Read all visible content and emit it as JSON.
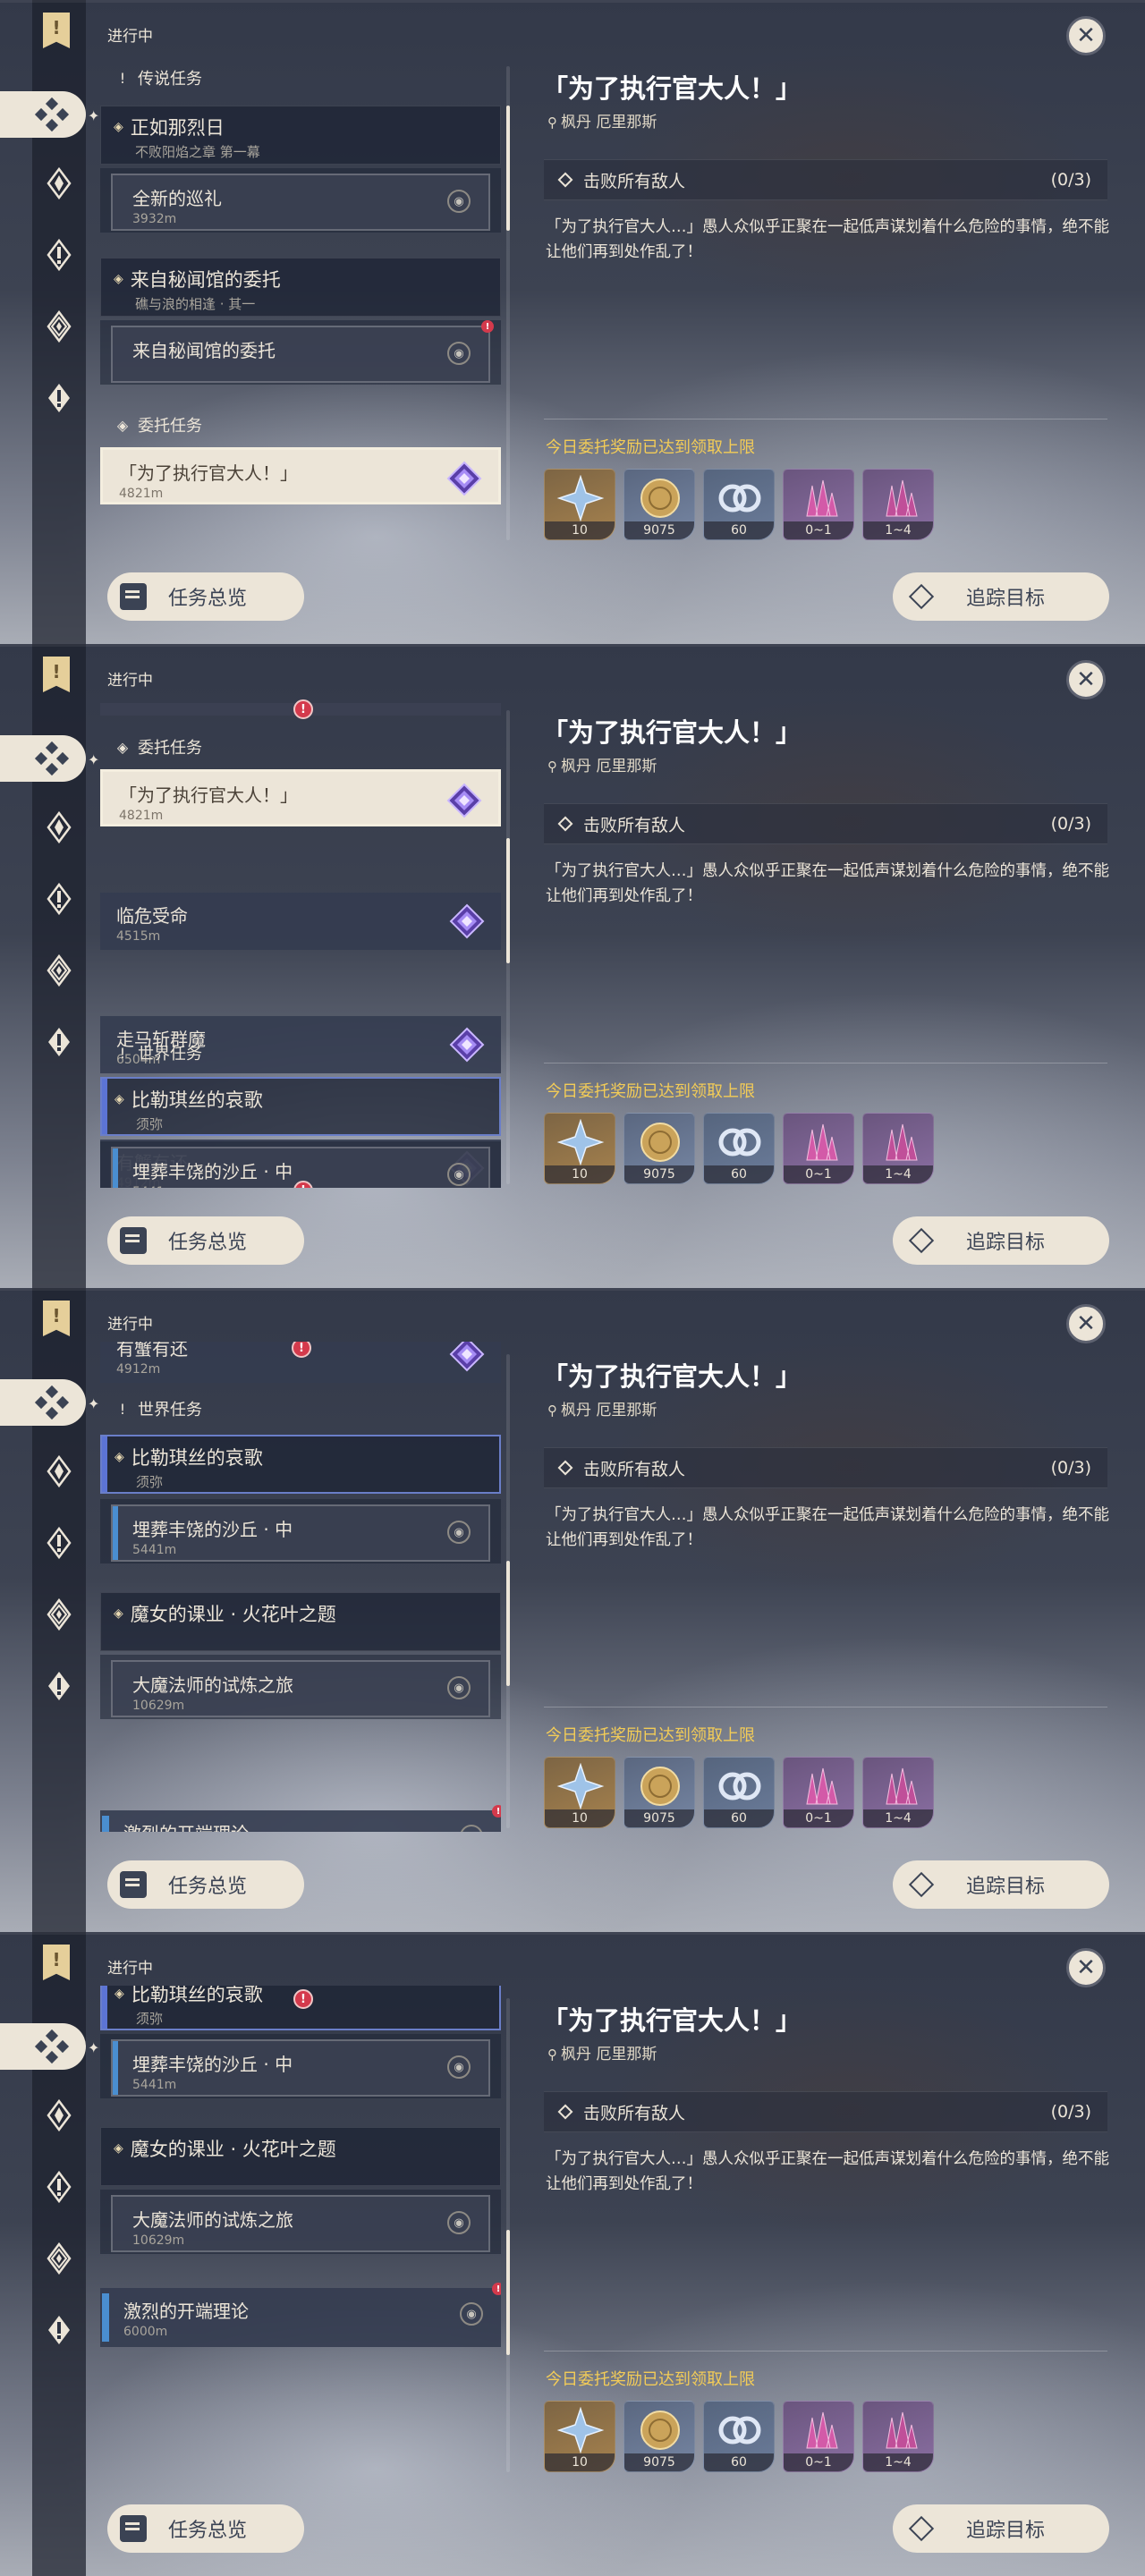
{
  "status_label": "进行中",
  "sections": {
    "legend": "传说任务",
    "commission": "委托任务",
    "world": "世界任务"
  },
  "quests": {
    "lieri": {
      "title": "正如那烈日",
      "sub": "不败阳焰之章 第一幕"
    },
    "xunli": {
      "title": "全新的巡礼",
      "dist": "3932m"
    },
    "mimi": {
      "title": "来自秘闻馆的委托",
      "sub": "礁与浪的相逢 · 其一"
    },
    "mimi_child": {
      "title": "来自秘闻馆的委托"
    },
    "zhixing": {
      "title": "「为了执行官大人！」",
      "dist": "4821m"
    },
    "linwei": {
      "title": "临危受命",
      "dist": "4515m"
    },
    "zouma": {
      "title": "走马斩群魔",
      "dist": "6504m"
    },
    "youxie": {
      "title": "有蟹有还",
      "dist": "4912m"
    },
    "bileqi": {
      "title": "比勒琪丝的哀歌",
      "sub": "须弥"
    },
    "maizang": {
      "title": "埋葬丰饶的沙丘 · 中",
      "dist": "5441m"
    },
    "monv": {
      "title": "魔女的课业 · 火花叶之题"
    },
    "damofa": {
      "title": "大魔法师的试炼之旅",
      "dist": "10629m"
    },
    "jilie": {
      "title": "激烈的开端理论",
      "dist": "6000m"
    }
  },
  "buttons": {
    "overview": "任务总览",
    "track": "追踪目标"
  },
  "detail": {
    "title": "「为了执行官大人！」",
    "location": "枫丹 厄里那斯",
    "objective": "击败所有敌人",
    "progress": "(0/3)",
    "description": "「为了执行官大人…」愚人众似乎正聚在一起低声谋划着什么危险的事情，绝不能让他们再到处作乱了！",
    "reward_label": "今日委托奖励已达到领取上限",
    "rewards": [
      "10",
      "9075",
      "60",
      "0~1",
      "1~4"
    ]
  },
  "icons": {
    "close": "close-icon",
    "pin": "map-pin-icon",
    "gem": "commission-gem-icon"
  },
  "colors": {
    "accent_gold": "#f3cc57",
    "cream": "#ece5d8",
    "alert_red": "#d43a4c",
    "world_blue": "#4a8ed0"
  }
}
